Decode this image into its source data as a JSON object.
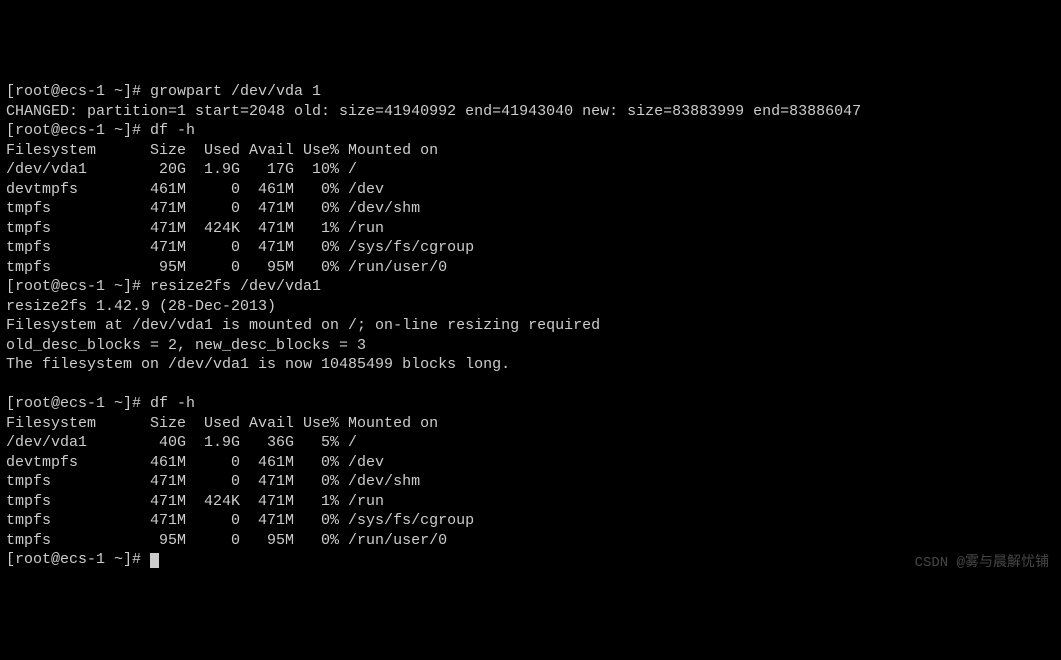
{
  "prompt": "[root@ecs-1 ~]# ",
  "cmd1": "growpart /dev/vda 1",
  "out1": "CHANGED: partition=1 start=2048 old: size=41940992 end=41943040 new: size=83883999 end=83886047",
  "cmd2": "df -h",
  "df1": {
    "header": "Filesystem      Size  Used Avail Use% Mounted on",
    "rows": [
      "/dev/vda1        20G  1.9G   17G  10% /",
      "devtmpfs        461M     0  461M   0% /dev",
      "tmpfs           471M     0  471M   0% /dev/shm",
      "tmpfs           471M  424K  471M   1% /run",
      "tmpfs           471M     0  471M   0% /sys/fs/cgroup",
      "tmpfs            95M     0   95M   0% /run/user/0"
    ]
  },
  "cmd3": "resize2fs /dev/vda1",
  "out3": [
    "resize2fs 1.42.9 (28-Dec-2013)",
    "Filesystem at /dev/vda1 is mounted on /; on-line resizing required",
    "old_desc_blocks = 2, new_desc_blocks = 3",
    "The filesystem on /dev/vda1 is now 10485499 blocks long."
  ],
  "blank": "",
  "cmd4": "df -h",
  "df2": {
    "header": "Filesystem      Size  Used Avail Use% Mounted on",
    "rows": [
      "/dev/vda1        40G  1.9G   36G   5% /",
      "devtmpfs        461M     0  461M   0% /dev",
      "tmpfs           471M     0  471M   0% /dev/shm",
      "tmpfs           471M  424K  471M   1% /run",
      "tmpfs           471M     0  471M   0% /sys/fs/cgroup",
      "tmpfs            95M     0   95M   0% /run/user/0"
    ]
  },
  "watermark": "CSDN @雾与晨解忧铺"
}
